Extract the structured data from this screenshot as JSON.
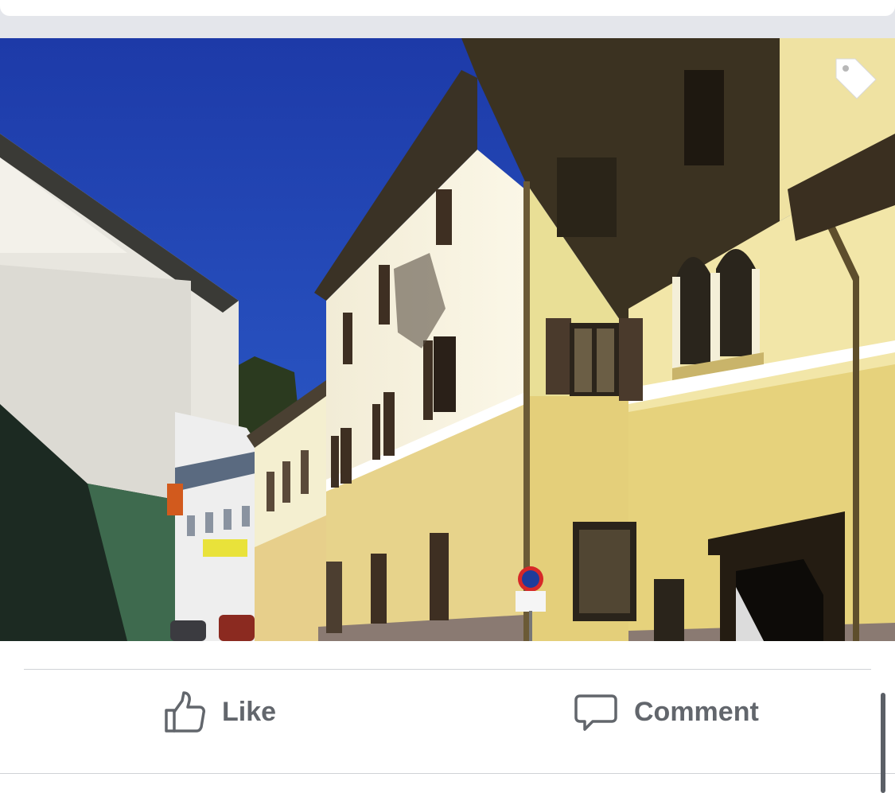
{
  "post": {
    "photo": {
      "icon": "tag-icon"
    },
    "actions": {
      "like": {
        "label": "Like",
        "icon": "thumbs-up-icon"
      },
      "comment": {
        "label": "Comment",
        "icon": "speech-bubble-icon"
      }
    }
  },
  "colors": {
    "feed_background": "#e4e6eb",
    "action_text": "#62666c",
    "divider": "#d0d2d6"
  }
}
